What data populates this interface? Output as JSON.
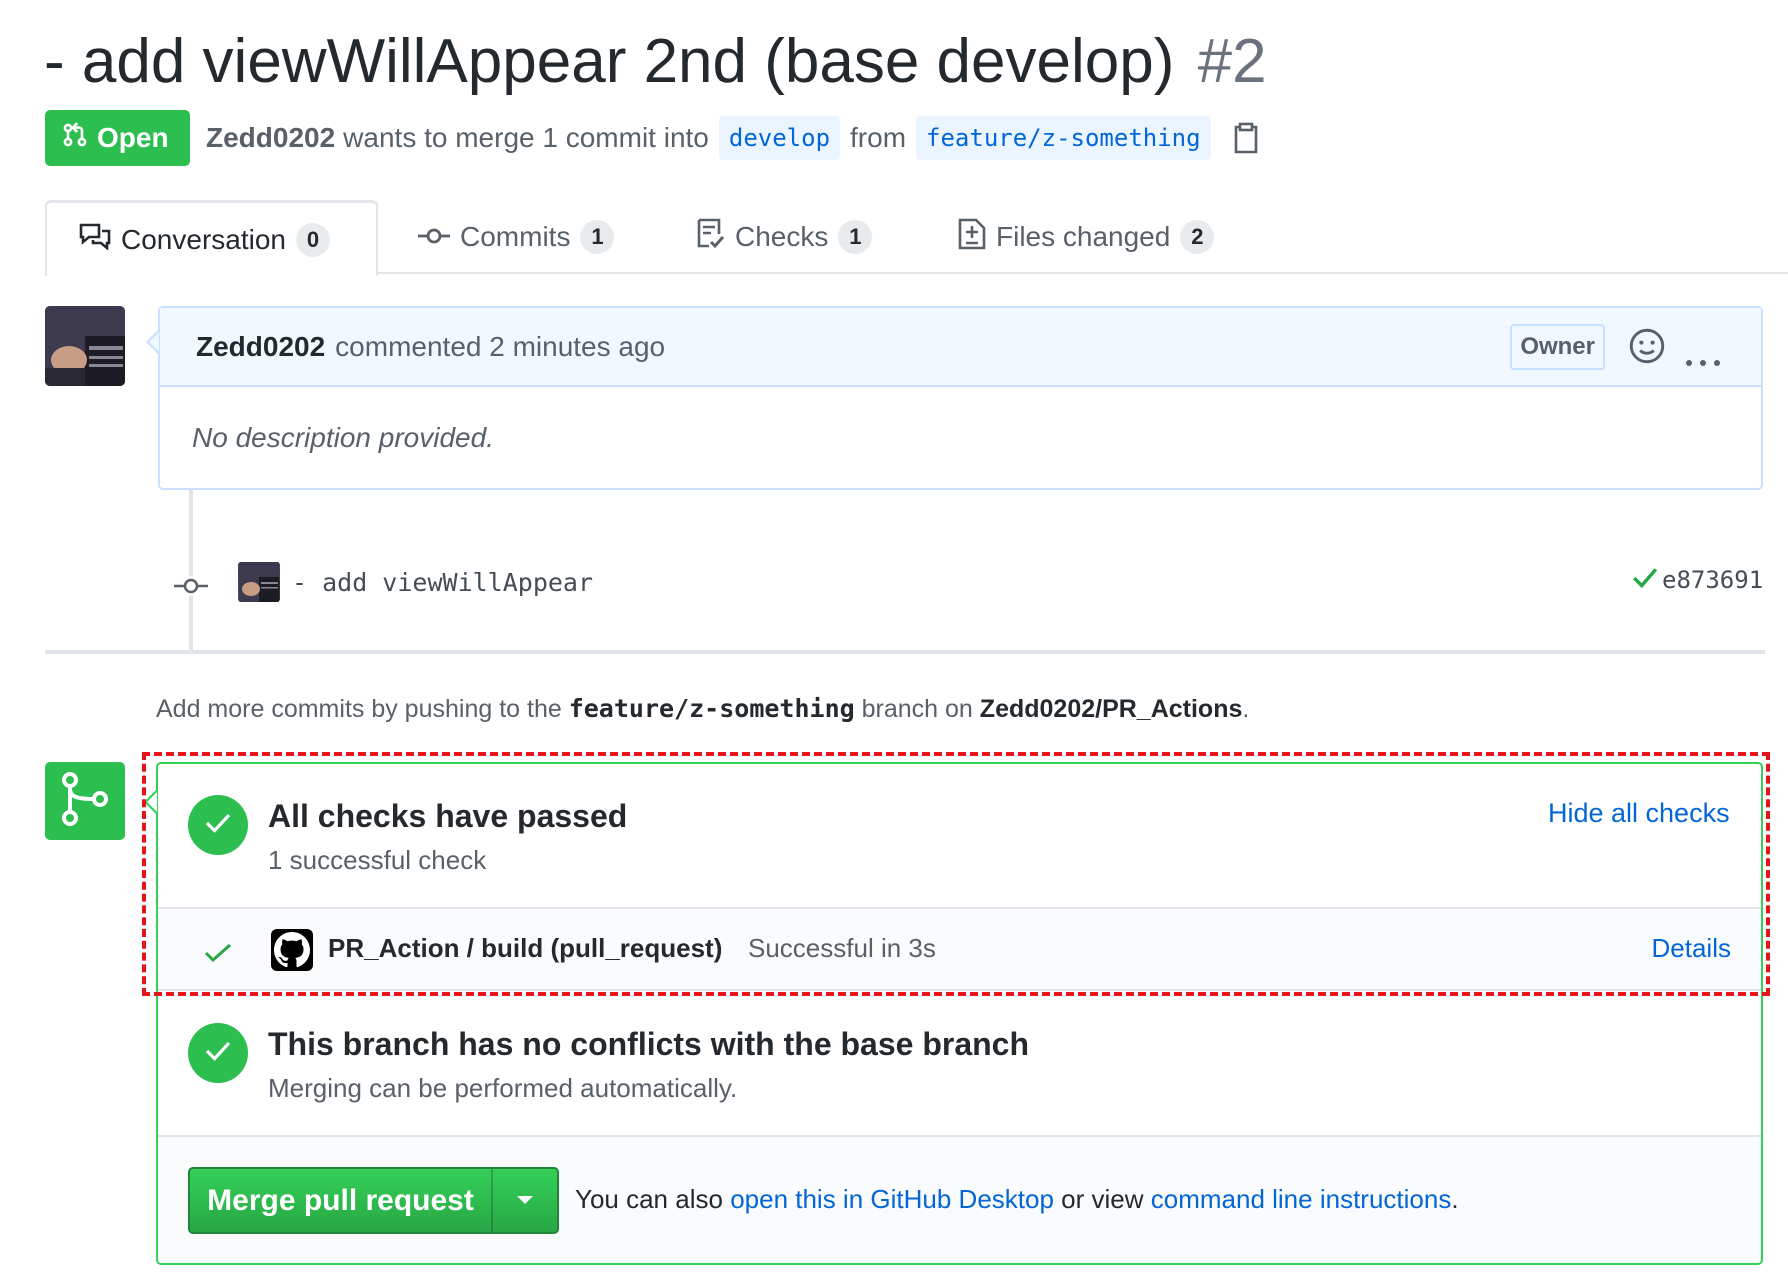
{
  "pr": {
    "title": "- add viewWillAppear 2nd (base develop)",
    "number": "#2",
    "state": "Open",
    "author": "Zedd0202",
    "merge_text": "wants to merge 1 commit into",
    "base_branch": "develop",
    "from_text": "from",
    "head_branch": "feature/z-something"
  },
  "tabs": [
    {
      "label": "Conversation",
      "count": "0",
      "icon": "comment-discussion-icon"
    },
    {
      "label": "Commits",
      "count": "1",
      "icon": "git-commit-icon"
    },
    {
      "label": "Checks",
      "count": "1",
      "icon": "checklist-icon"
    },
    {
      "label": "Files changed",
      "count": "2",
      "icon": "diff-icon"
    }
  ],
  "comment": {
    "author": "Zedd0202",
    "meta": "commented 2 minutes ago",
    "badge": "Owner",
    "body": "No description provided."
  },
  "commit": {
    "message": "- add viewWillAppear",
    "sha": "e873691",
    "status_color": "#28a745"
  },
  "push_hint": {
    "prefix": "Add more commits by pushing to the",
    "branch": "feature/z-something",
    "middle": "branch on",
    "repo": "Zedd0202/PR_Actions",
    "suffix": "."
  },
  "checks": {
    "title": "All checks have passed",
    "subtitle": "1 successful check",
    "toggle": "Hide all checks",
    "items": [
      {
        "name": "PR_Action / build (pull_request)",
        "status": "Successful in 3s",
        "details": "Details"
      }
    ]
  },
  "conflicts": {
    "title": "This branch has no conflicts with the base branch",
    "subtitle": "Merging can be performed automatically."
  },
  "merge": {
    "button": "Merge pull request",
    "hint_prefix": "You can also",
    "desktop_link": "open this in GitHub Desktop",
    "hint_middle": "or view",
    "cli_link": "command line instructions",
    "hint_suffix": "."
  },
  "colors": {
    "success": "#2cbe4e",
    "link": "#0366d6",
    "highlight": "#e3151a"
  }
}
